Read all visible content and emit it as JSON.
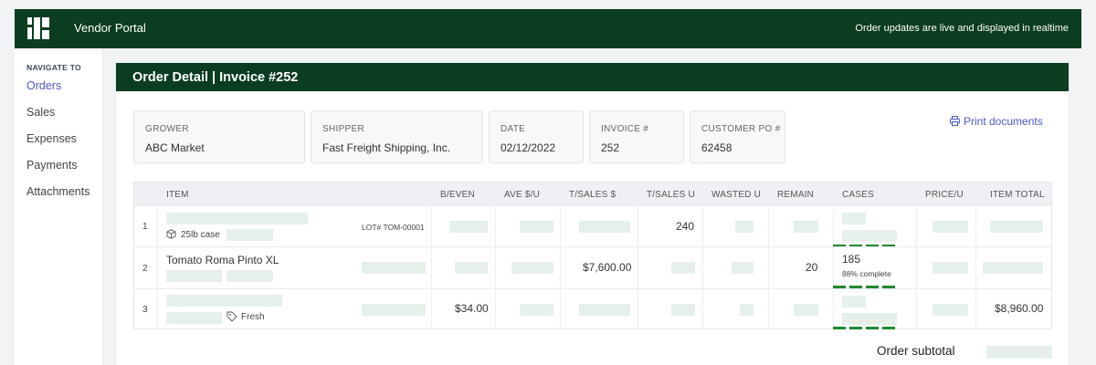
{
  "app": {
    "title": "Vendor Portal",
    "live_notice": "Order updates are live and displayed in realtime"
  },
  "sidebar": {
    "heading": "NAVIGATE TO",
    "items": [
      {
        "label": "Orders",
        "active": true
      },
      {
        "label": "Sales"
      },
      {
        "label": "Expenses"
      },
      {
        "label": "Payments"
      },
      {
        "label": "Attachments"
      }
    ]
  },
  "order": {
    "title": "Order Detail | Invoice #252",
    "print_label": "Print documents",
    "info": {
      "grower": {
        "label": "GROWER",
        "value": "ABC Market"
      },
      "shipper": {
        "label": "SHIPPER",
        "value": "Fast Freight Shipping, Inc."
      },
      "date": {
        "label": "DATE",
        "value": "02/12/2022"
      },
      "invoice": {
        "label": "INVOICE #",
        "value": "252"
      },
      "customer_po": {
        "label": "CUSTOMER PO #",
        "value": "62458"
      }
    }
  },
  "table": {
    "headers": [
      "ITEM",
      "B/EVEN",
      "AVE $/U",
      "T/SALES $",
      "T/SALES U",
      "WASTED U",
      "REMAIN",
      "CASES",
      "PRICE/U",
      "ITEM TOTAL"
    ],
    "rows": [
      {
        "num": "1",
        "case_label": "25lb case",
        "lot": "LOT# TOM-00001",
        "tsales_u": "240",
        "cases_progress": 0.7
      },
      {
        "num": "2",
        "name": "Tomato Roma Pinto XL",
        "tsales_dollars": "$7,600.00",
        "remain": "20",
        "cases": "185",
        "cases_note": "88% complete",
        "cases_progress": 0.88
      },
      {
        "num": "3",
        "tag": "Fresh",
        "beven": "$34.00",
        "item_total": "$8,960.00",
        "cases_progress": 0.88
      }
    ]
  },
  "subtotal": {
    "label": "Order subtotal"
  },
  "colors": {
    "brand_green": "#0b3d20",
    "link_blue": "#4b58c9",
    "progress_green": "#1f8a2c",
    "placeholder": "#e6f0ea"
  }
}
